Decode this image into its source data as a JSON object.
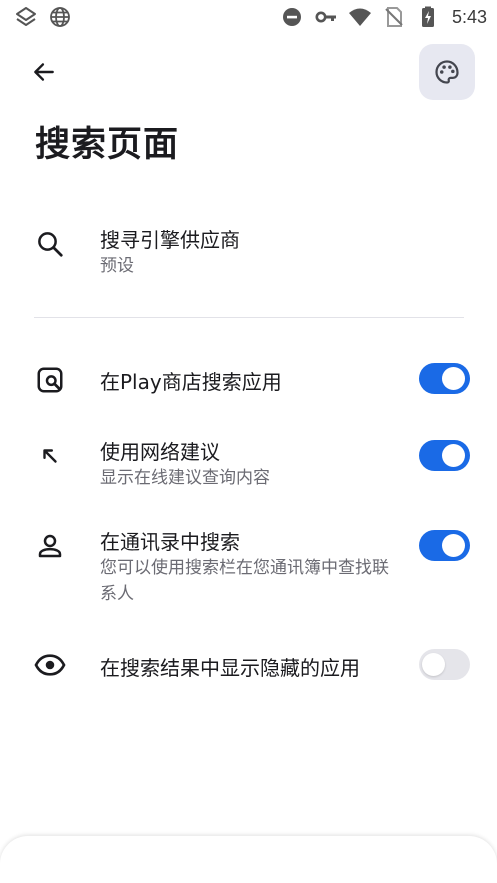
{
  "status_bar": {
    "time": "5:43",
    "icons": [
      "layers-icon",
      "globe-icon",
      "do-not-disturb-icon",
      "vpn-key-icon",
      "wifi-icon",
      "no-sim-icon",
      "battery-charging-icon"
    ]
  },
  "header": {
    "back_icon": "arrow-left-icon",
    "theme_icon": "palette-icon",
    "title": "搜索页面"
  },
  "search_engine": {
    "icon": "search-icon",
    "title": "搜寻引擎供应商",
    "subtitle": "预设"
  },
  "settings": [
    {
      "icon": "store-search-icon",
      "title": "在Play商店搜索应用",
      "subtitle": "",
      "enabled": true
    },
    {
      "icon": "arrow-up-left-icon",
      "title": "使用网络建议",
      "subtitle": "显示在线建议查询内容",
      "enabled": true
    },
    {
      "icon": "person-icon",
      "title": "在通讯录中搜索",
      "subtitle": "您可以使用搜索栏在您通讯簿中查找联系人",
      "enabled": true
    },
    {
      "icon": "eye-icon",
      "title": "在搜索结果中显示隐藏的应用",
      "subtitle": "",
      "enabled": false
    }
  ],
  "colors": {
    "accent": "#1a6ae6",
    "toggle_off": "#e5e5ea",
    "theme_button_bg": "#e7e8f1"
  }
}
